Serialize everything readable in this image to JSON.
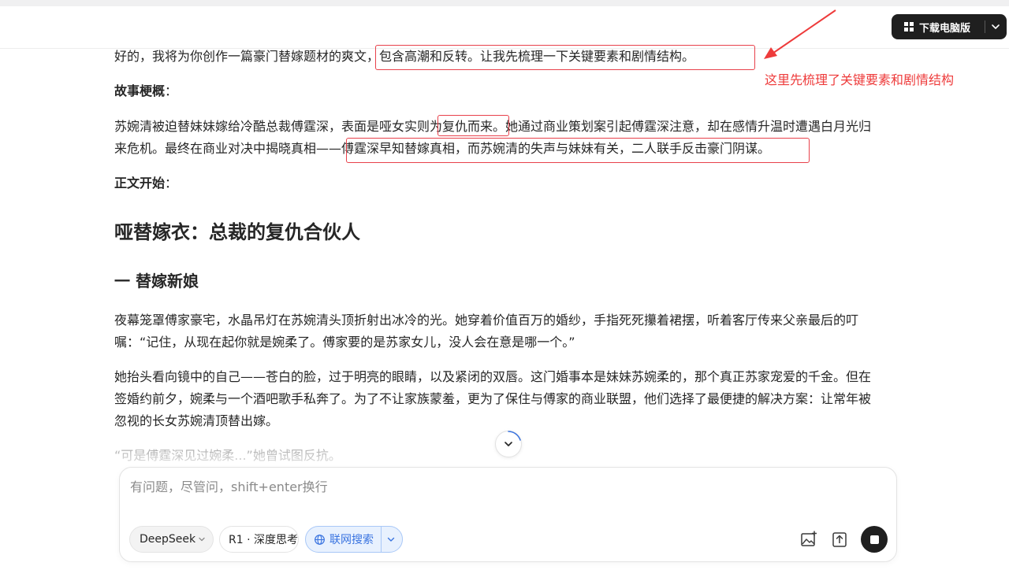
{
  "header": {
    "download_label": "下载电脑版"
  },
  "chat": {
    "intro": "好的，我将为你创作一篇豪门替嫁题材的爽文，包含高潮和反转。让我先梳理一下关键要素和剧情结构。",
    "summary_label": "故事梗概",
    "summary_colon": "：",
    "summary_line1": "苏婉清被迫替妹妹嫁给冷酷总裁傅霆深，表面是哑女实则为复仇而来。她通过商业策划案引起傅霆深注意，却在感情升温时遭遇白月光归",
    "summary_line2": "来危机。最终在商业对决中揭晓真相——傅霆深早知替嫁真相，而苏婉清的失声与妹妹有关，二人联手反击豪门阴谋。",
    "body_label": "正文开始",
    "body_colon": "：",
    "story_title": "哑替嫁衣：总裁的复仇合伙人",
    "chapter_title": "一 替嫁新娘",
    "para1_line1": "夜幕笼罩傅家豪宅，水晶吊灯在苏婉清头顶折射出冰冷的光。她穿着价值百万的婚纱，手指死死攥着裙摆，听着客厅传来父亲最后的叮",
    "para1_line2": "嘱：“记住，从现在起你就是婉柔了。傅家要的是苏家女儿，没人会在意是哪一个。”",
    "para2_line1": "她抬头看向镜中的自己——苍白的脸，过于明亮的眼睛，以及紧闭的双唇。这门婚事本是妹妹苏婉柔的，那个真正苏家宠爱的千金。但在",
    "para2_line2": "签婚约前夕，婉柔与一个酒吧歌手私奔了。为了不让家族蒙羞，更为了保住与傅家的商业联盟，他们选择了最便捷的解决方案：让常年被",
    "para2_line3": "忽视的长女苏婉清顶替出嫁。",
    "para3_line1": "“可是傅霆深见过婉柔...”她曾试图反抗。"
  },
  "annotation": {
    "note": "这里先梳理了关键要素和剧情结构",
    "color": "#ee3b3b"
  },
  "composer": {
    "placeholder": "有问题，尽管问，shift+enter换行",
    "model_label": "DeepSeek",
    "think_label": "R1 · 深度思考",
    "search_label": "联网搜索",
    "accent": "#3a74e0"
  },
  "icons": {
    "download": "windows-icon",
    "scroll": "chevron-down-icon",
    "image": "image-add-icon",
    "upload": "upload-icon",
    "send": "stop-icon"
  }
}
